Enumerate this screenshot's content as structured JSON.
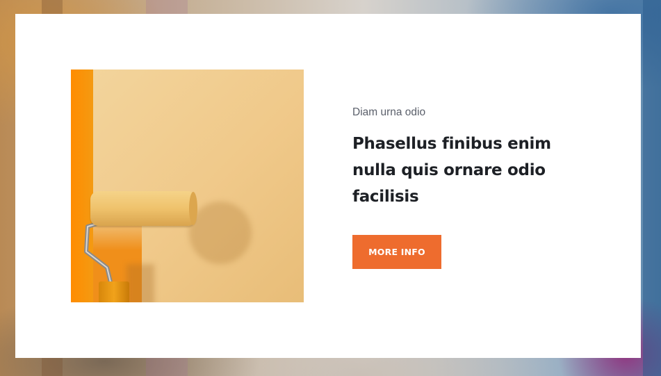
{
  "promo": {
    "eyebrow": "Diam urna odio",
    "headline": "Phasellus finibus enim nulla quis ornare odio facilisis",
    "cta_label": "MORE INFO"
  },
  "image": {
    "subject": "paint-roller-on-wall"
  },
  "colors": {
    "accent": "#ee6c2e",
    "heading": "#1d2025",
    "subtext": "#5a5f6a",
    "card": "#ffffff"
  }
}
